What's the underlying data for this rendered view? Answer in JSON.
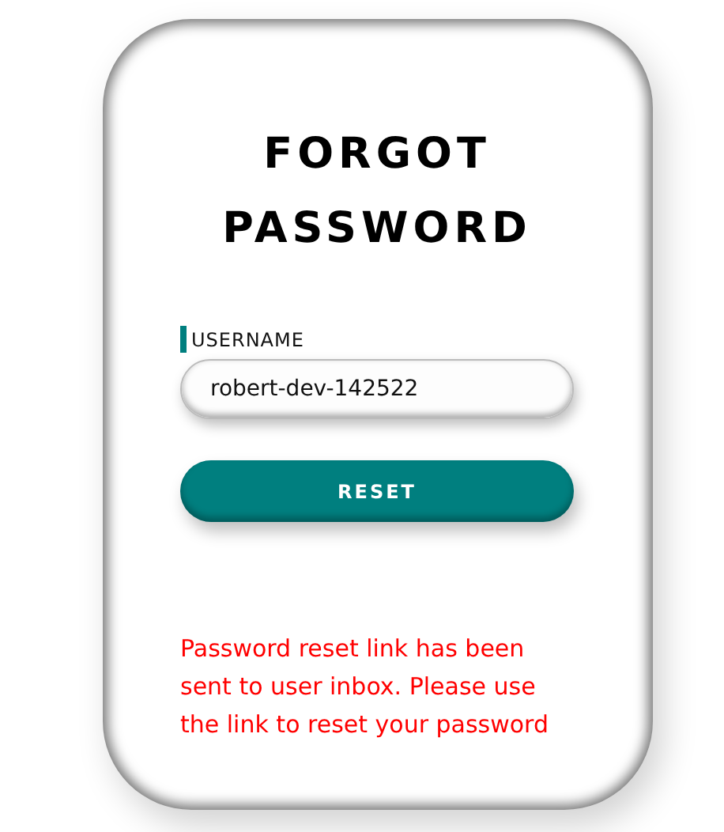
{
  "title_lines": [
    "FORGOT",
    "PASSWORD"
  ],
  "username": {
    "label": "USERNAME",
    "value": "robert-dev-142522"
  },
  "reset_button": {
    "label": "RESET"
  },
  "message": "Password reset link has been sent to user inbox. Please use the link to reset your password"
}
